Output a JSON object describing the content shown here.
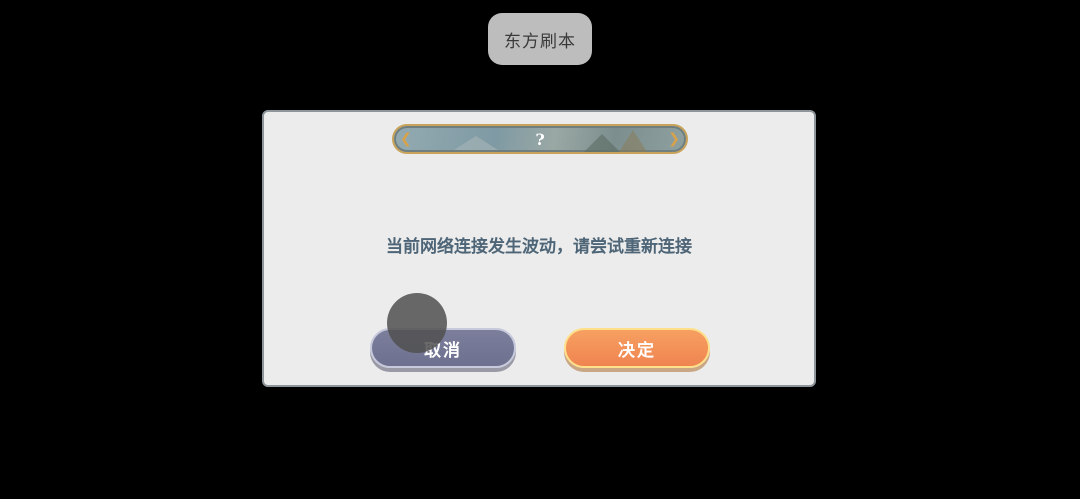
{
  "toast": {
    "label": "东方刷本"
  },
  "dialog": {
    "title": "?",
    "title_left_icon": "chevron-left-icon",
    "title_right_icon": "chevron-right-icon",
    "message": "当前网络连接发生波动，请尝试重新连接",
    "cancel_label": "取消",
    "confirm_label": "决定"
  },
  "colors": {
    "background": "#000000",
    "dialog_bg": "#ececec",
    "message_text": "#4d6577",
    "cancel_button": "#72758f",
    "confirm_button": "#f28f57",
    "banner_border": "#c9a35a"
  }
}
